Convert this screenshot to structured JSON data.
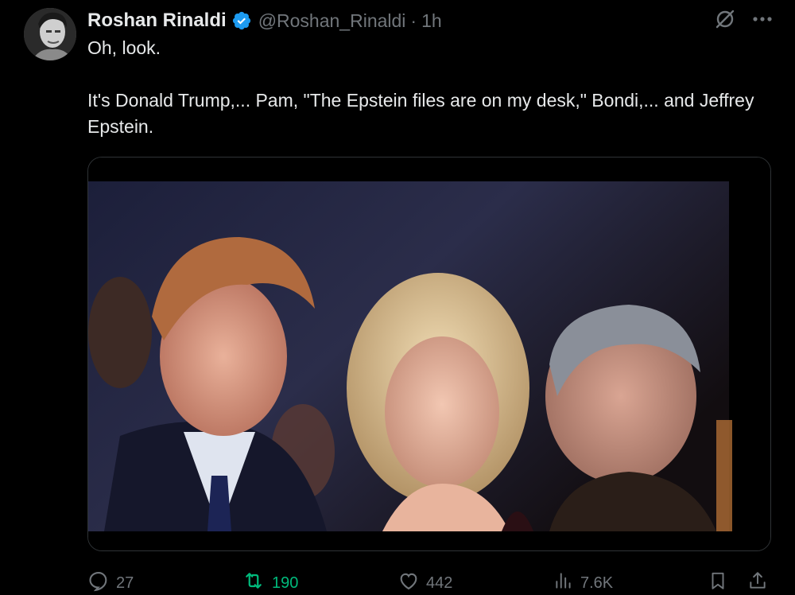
{
  "author": {
    "display_name": "Roshan Rinaldi",
    "handle": "@Roshan_Rinaldi",
    "separator": "·",
    "time": "1h",
    "verified": true
  },
  "tweet": {
    "line1": "Oh, look.",
    "line2": "It's Donald Trump,... Pam, \"The Epstein files are on my desk,\" Bondi,... and Jeffrey Epstein."
  },
  "media": {
    "kind": "photo"
  },
  "stats": {
    "replies": "27",
    "retweets": "190",
    "likes": "442",
    "views": "7.6K"
  },
  "icons": {
    "verified": "verified-badge-icon",
    "grok": "grok-icon",
    "more": "more-icon",
    "reply": "reply-icon",
    "retweet": "retweet-icon",
    "like": "like-icon",
    "views": "views-icon",
    "bookmark": "bookmark-icon",
    "share": "share-icon"
  },
  "colors": {
    "background": "#000000",
    "text": "#e7e9ea",
    "muted": "#71767b",
    "verified": "#1d9bf0",
    "retweet_active": "#00ba7c",
    "border": "#2f3336"
  }
}
